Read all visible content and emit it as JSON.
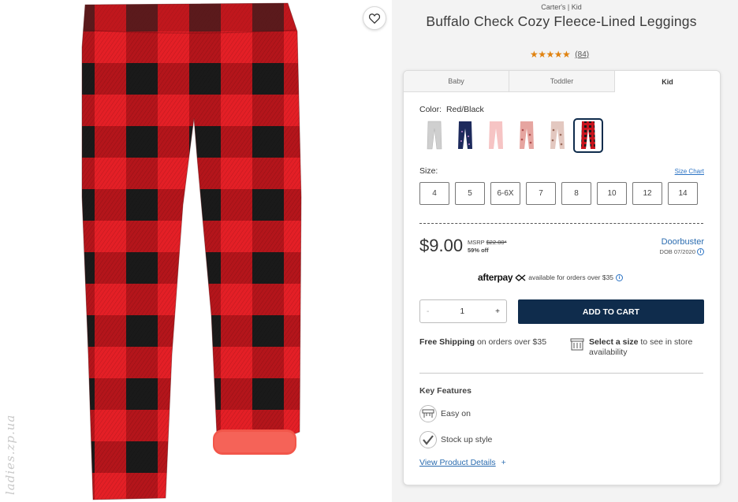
{
  "product": {
    "brand_line": "Carter's | Kid",
    "title": "Buffalo Check Cozy Fleece-Lined Leggings",
    "stars": "★★★★★",
    "rating": 4.5,
    "review_count": "(84)",
    "watermark": "ladies.zp.ua"
  },
  "icons": {
    "favorite": "heart-outline-icon",
    "info": "info-circle-icon",
    "store": "store-icon",
    "easy_on": "waistband-icon",
    "stock_up": "checkmark-icon"
  },
  "tabs": [
    {
      "label": "Baby"
    },
    {
      "label": "Toddler"
    },
    {
      "label": "Kid"
    }
  ],
  "color": {
    "label": "Color:",
    "selected": "Red/Black",
    "swatches": [
      {
        "name": "gray",
        "color": "#cfcfcf"
      },
      {
        "name": "navy",
        "color": "#1d2a5c"
      },
      {
        "name": "pink",
        "color": "#f6c4c4"
      },
      {
        "name": "floral-pink",
        "color": "#e6a5a0"
      },
      {
        "name": "floral-beige",
        "color": "#e3c8c0"
      },
      {
        "name": "red-black-plaid",
        "color": "#b01624",
        "selected": true
      }
    ]
  },
  "size": {
    "label": "Size:",
    "chart_link": "Size Chart",
    "options": [
      "4",
      "5",
      "6-6X",
      "7",
      "8",
      "10",
      "12",
      "14"
    ]
  },
  "pricing": {
    "price": "$9.00",
    "msrp_label": "MSRP",
    "msrp": "$22.00*",
    "discount": "59% off",
    "badge": "Doorbuster",
    "dob": "DOB 07/2020"
  },
  "afterpay": {
    "logo": "afterpay",
    "text": "available for orders over $35"
  },
  "cart": {
    "minus": "-",
    "qty": "1",
    "plus": "+",
    "add_label": "ADD TO CART"
  },
  "shipping": {
    "bold": "Free Shipping",
    "text": "on orders over $35"
  },
  "store": {
    "bold": "Select a size",
    "text": "to see in store availability"
  },
  "features": {
    "title": "Key Features",
    "items": [
      {
        "label": "Easy on"
      },
      {
        "label": "Stock up style"
      }
    ],
    "details_link": "View Product Details",
    "details_plus": "+"
  },
  "colors": {
    "accent_navy": "#0f2c4c",
    "link_blue": "#2b6cb0",
    "star_orange": "#e0820f",
    "plaid_red": "#e41f26",
    "plaid_black": "#1a1a1a"
  }
}
